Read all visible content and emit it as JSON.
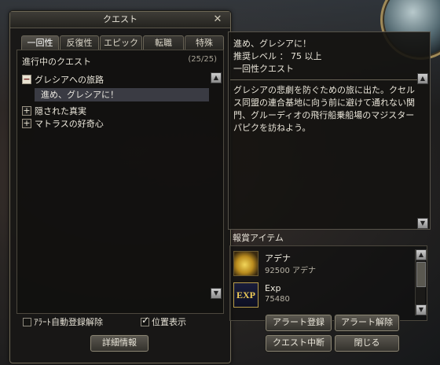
{
  "window": {
    "title": "クエスト",
    "close": "✕"
  },
  "tabs": [
    "一回性",
    "反復性",
    "エピック",
    "転職",
    "特殊"
  ],
  "quest_list": {
    "header": "進行中のクエスト",
    "count": "(25/25)",
    "groups": [
      {
        "label": "グレシアへの旅路",
        "expanded": true
      },
      {
        "label": "隠された真実",
        "expanded": false
      },
      {
        "label": "マトラスの好奇心",
        "expanded": false
      }
    ],
    "selected_subquest": "進め、グレシアに！"
  },
  "options": {
    "alert_auto_unregister": "ｱﾗｰﾄ自動登録解除",
    "show_location": "位置表示",
    "details_button": "詳細情報"
  },
  "detail": {
    "title": "進め、グレシアに！",
    "level": "推奨レベル ： 75 以上",
    "type": "一回性クエスト",
    "description": "グレシアの悲劇を防ぐための旅に出た。クセルス同盟の連合基地に向う前に避けて通れない関門、グルーディオの飛行船乗船場のマジスター パピクを訪ねよう。"
  },
  "rewards": {
    "header": "報賞アイテム",
    "items": [
      {
        "name": "アデナ",
        "value": "92500 アデナ",
        "icon": "adena-icon"
      },
      {
        "name": "Exp",
        "value": "75480",
        "icon": "exp-icon",
        "icon_text": "EXP"
      }
    ]
  },
  "buttons": {
    "alert_register": "アラート登録",
    "alert_release": "アラート解除",
    "quest_abort": "クエスト中断",
    "close": "閉じる"
  },
  "colors": {
    "selected_row": "#3a3b43",
    "gold_border": "#8a7a4a"
  }
}
